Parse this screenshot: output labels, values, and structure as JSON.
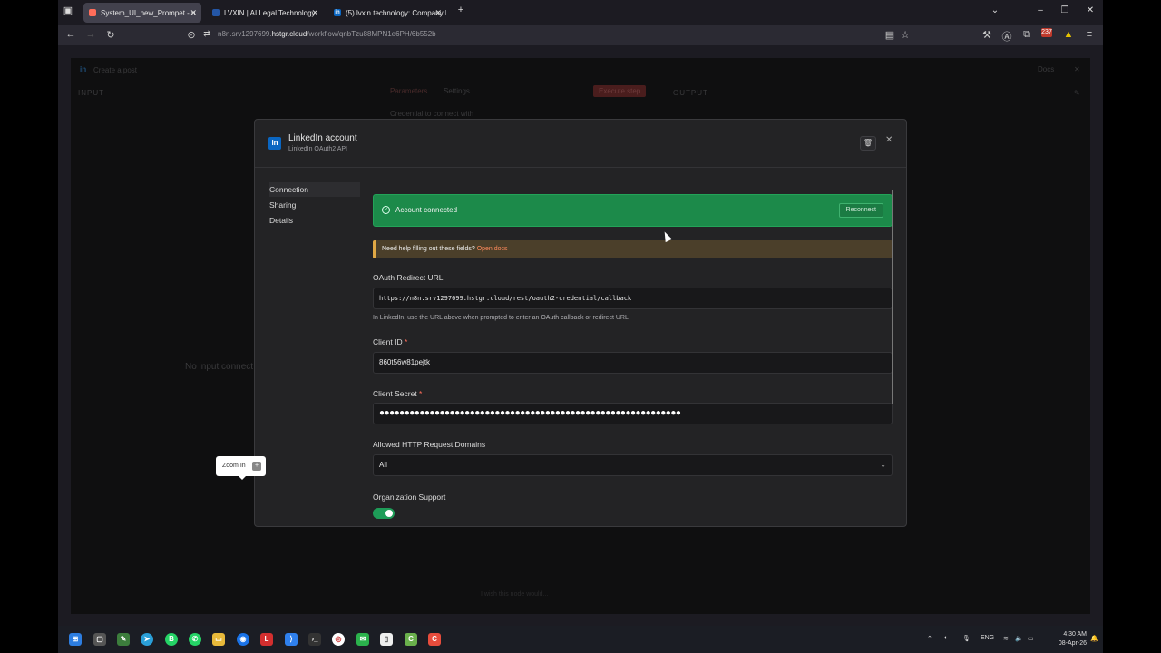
{
  "browser": {
    "tabs": [
      {
        "label": "System_UI_new_Prompet - n",
        "active": true
      },
      {
        "label": "LVXIN | AI Legal Technology",
        "active": false
      },
      {
        "label": "(5) lvxin technology: Company P",
        "active": false
      }
    ],
    "url_prefix": "n8n.srv1297699.",
    "url_host": "hstgr.cloud",
    "url_path": "/workflow/qnbTzu88MPN1e6PH/6b552b",
    "notif_count": "237"
  },
  "background": {
    "node_title": "Create a post",
    "input_label": "INPUT",
    "output_label": "OUTPUT",
    "tab_parameters": "Parameters",
    "tab_settings": "Settings",
    "execute_label": "Execute step",
    "credential_hint": "Credential to connect with",
    "no_input": "No input connect",
    "docs": "Docs",
    "footer_hint": "I wish this node would..."
  },
  "modal": {
    "title": "LinkedIn account",
    "subtitle": "LinkedIn OAuth2 API",
    "nav": [
      "Connection",
      "Sharing",
      "Details"
    ],
    "status_text": "Account connected",
    "reconnect_label": "Reconnect",
    "help_text": "Need help filling out these fields?",
    "help_link": "Open docs",
    "redirect_label": "OAuth Redirect URL",
    "redirect_value": "https://n8n.srv1297699.hstgr.cloud/rest/oauth2-credential/callback",
    "redirect_hint": "In LinkedIn, use the URL above when prompted to enter an OAuth callback or redirect URL",
    "client_id_label": "Client ID",
    "client_id_value": "860t56w81pejtk",
    "client_secret_label": "Client Secret",
    "client_secret_value": "●●●●●●●●●●●●●●●●●●●●●●●●●●●●●●●●●●●●●●●●●●●●●●●●●●●●●●●●●●●●",
    "domains_label": "Allowed HTTP Request Domains",
    "domains_value": "All",
    "org_support_label": "Organization Support",
    "org_support_on": true
  },
  "tooltip": {
    "label": "Zoom In",
    "key": "+"
  },
  "taskbar": {
    "lang": "ENG",
    "time": "4:30 AM",
    "date": "08-Apr-26"
  },
  "colors": {
    "accent_green": "#1c8a4a",
    "n8n_red": "#ff6d5a",
    "linkedin_blue": "#0a66c2"
  }
}
